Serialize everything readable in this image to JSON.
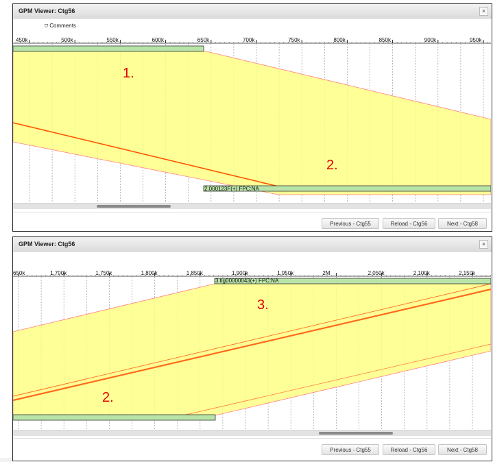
{
  "panels": [
    {
      "title": "GPM Viewer: Ctg56",
      "close_label": "×",
      "comments_label": "Comments",
      "axis_ticks": [
        "450k",
        "500k",
        "550k",
        "600k",
        "650k",
        "700k",
        "750k",
        "800k",
        "850k",
        "900k",
        "950k"
      ],
      "highlight_tick": null,
      "contig_label": "2.000123F(+) FPC:NA",
      "annotations": [
        "1.",
        "2."
      ],
      "buttons": {
        "prev": "Previous - Ctg55",
        "reload": "Reload - Ctg56",
        "next": "Next - Ctg58"
      }
    },
    {
      "title": "GPM Viewer: Ctg56",
      "close_label": "×",
      "axis_ticks": [
        "650k",
        "1,700k",
        "1,750k",
        "1,800k",
        "1,850k",
        "1,900k",
        "1,950k",
        "2M",
        "2,050k",
        "2,100k",
        "2,150k"
      ],
      "highlight_tick": "2M",
      "contig_label": "3.tig00000043(+) FPC:NA",
      "annotations": [
        "3.",
        "2."
      ],
      "buttons": {
        "prev": "Previous - Ctg55",
        "reload": "Reload - Ctg56",
        "next": "Next - Ctg58"
      }
    }
  ],
  "colors": {
    "alignment_fill": "#ffff80",
    "alignment_edge": "#ff8080",
    "diagonal": "#ff5500",
    "contig_fill": "#b9e4a8",
    "highlight_tick": "#ff0000",
    "annotation": "#e00000"
  }
}
